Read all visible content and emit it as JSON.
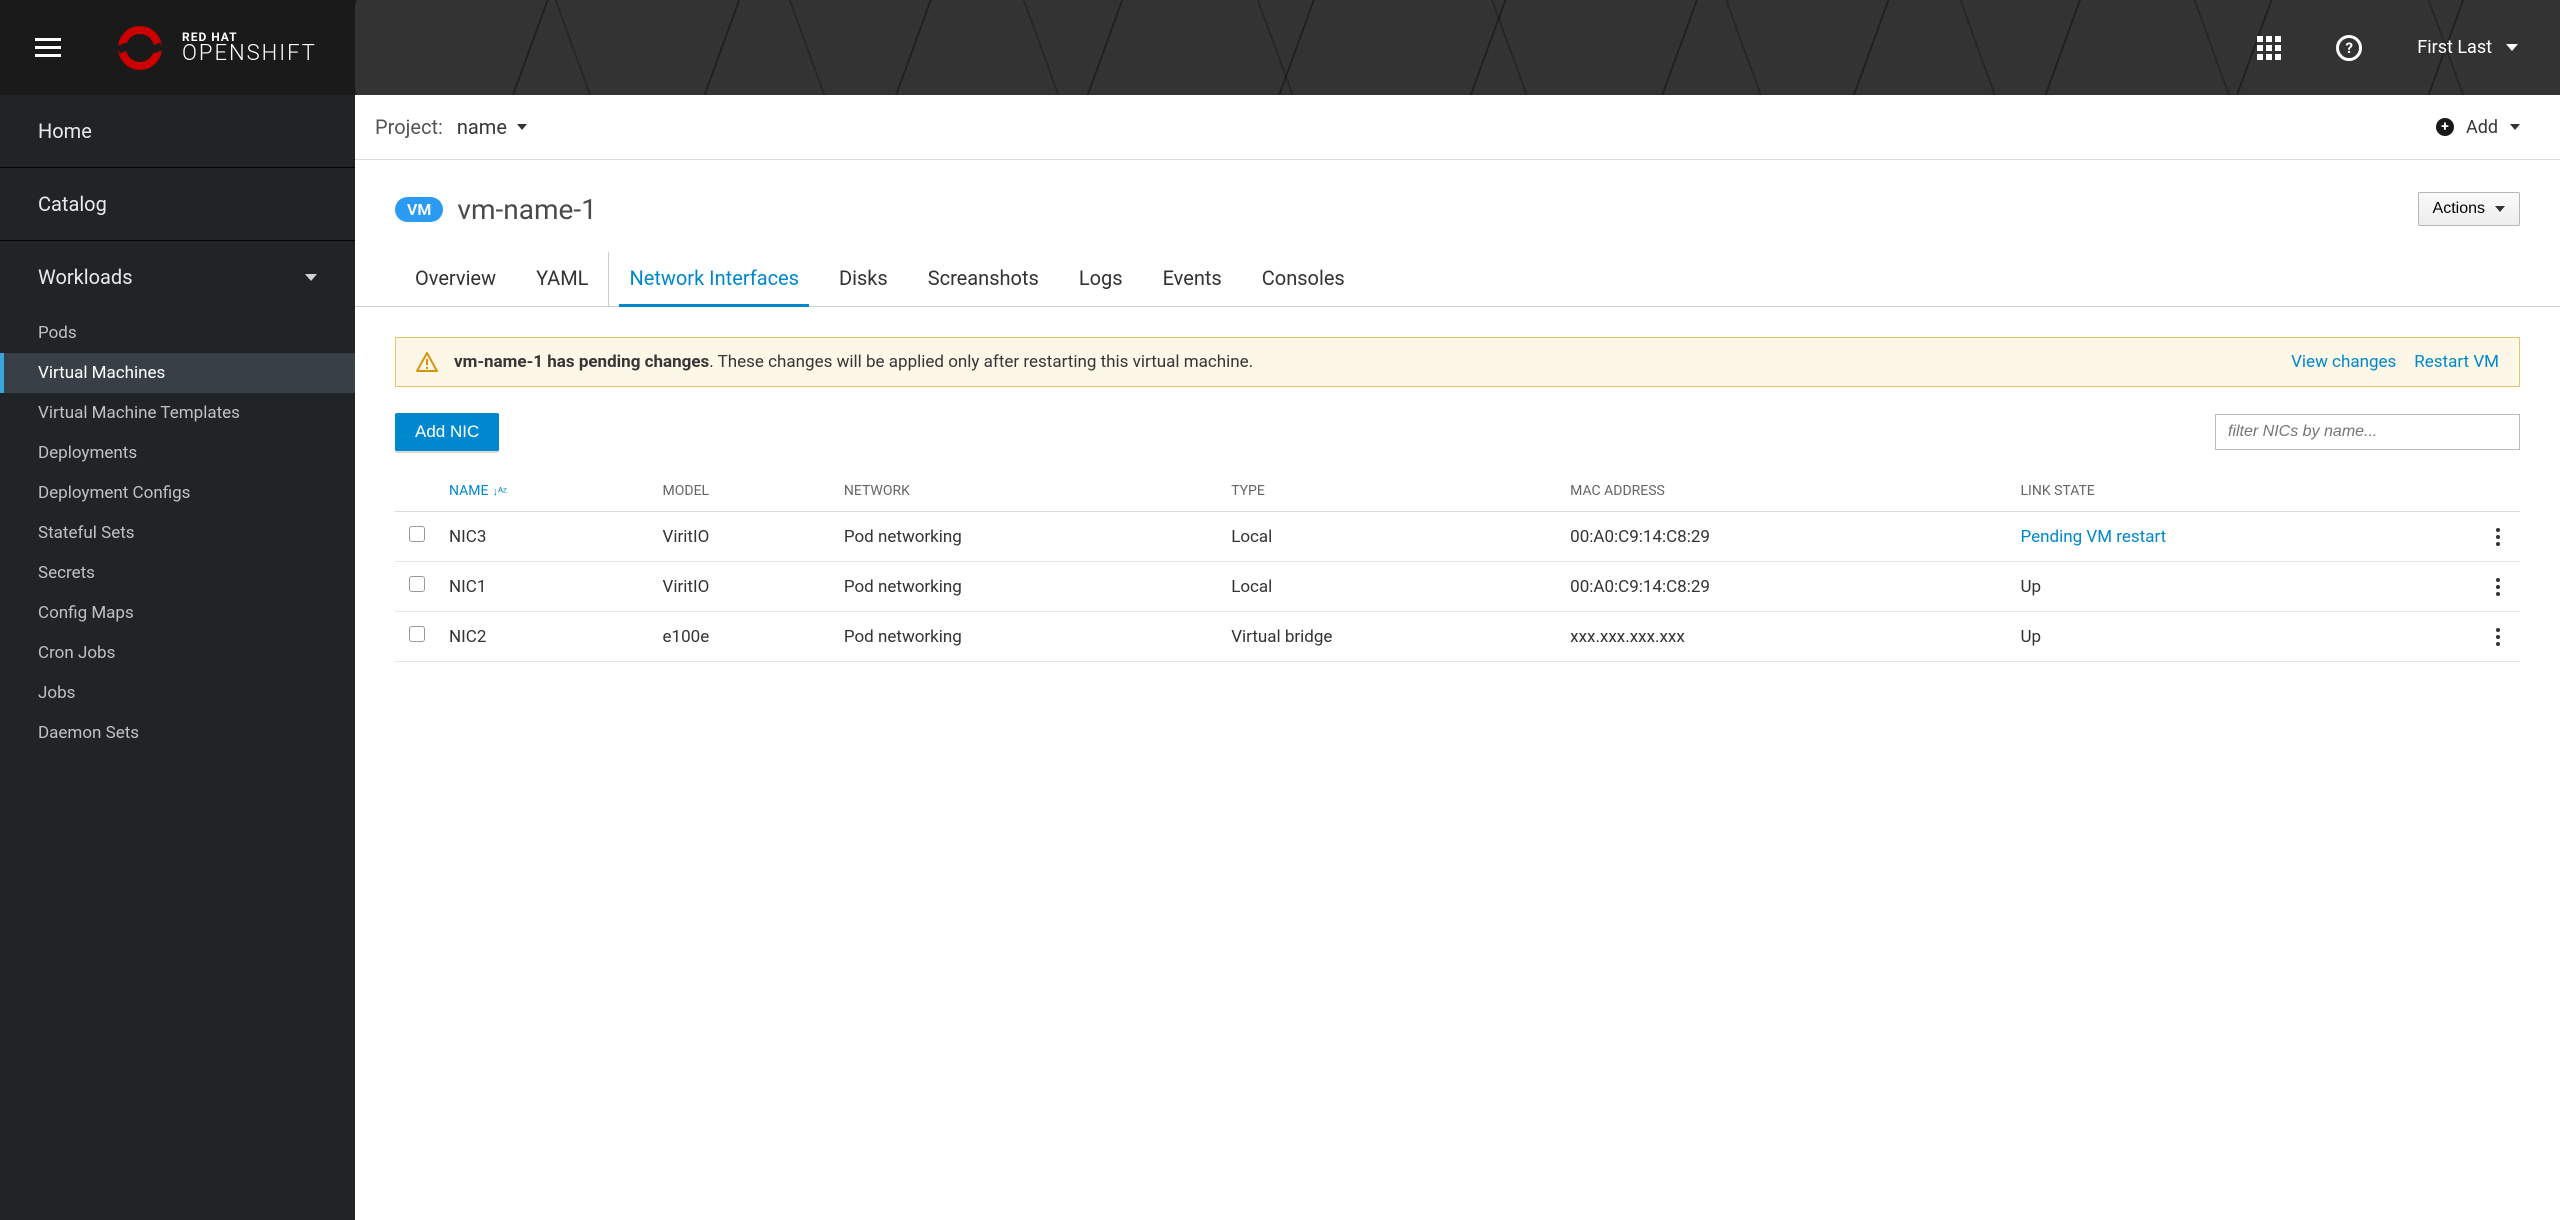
{
  "brand": {
    "line1": "RED HAT",
    "line2": "OPENSHIFT"
  },
  "topbar": {
    "user_name": "First Last"
  },
  "sidebar": {
    "home": "Home",
    "catalog": "Catalog",
    "workloads_label": "Workloads",
    "items": [
      {
        "label": "Pods"
      },
      {
        "label": "Virtual Machines"
      },
      {
        "label": "Virtual Machine Templates"
      },
      {
        "label": "Deployments"
      },
      {
        "label": "Deployment Configs"
      },
      {
        "label": "Stateful Sets"
      },
      {
        "label": "Secrets"
      },
      {
        "label": "Config Maps"
      },
      {
        "label": "Cron Jobs"
      },
      {
        "label": "Jobs"
      },
      {
        "label": "Daemon Sets"
      }
    ]
  },
  "project_bar": {
    "label": "Project:",
    "value": "name",
    "add_label": "Add"
  },
  "page": {
    "badge": "VM",
    "title": "vm-name-1",
    "actions_label": "Actions"
  },
  "tabs": [
    "Overview",
    "YAML",
    "Network Interfaces",
    "Disks",
    "Screanshots",
    "Logs",
    "Events",
    "Consoles"
  ],
  "alert": {
    "bold": "vm-name-1 has pending changes",
    "rest": ". These changes will be applied only after restarting this virtual machine.",
    "view_changes": "View changes",
    "restart": "Restart VM"
  },
  "toolbar": {
    "add_nic": "Add NIC",
    "filter_placeholder": "filter NICs by name..."
  },
  "table": {
    "headers": {
      "name": "NAME",
      "model": "MODEL",
      "network": "NETWORK",
      "type": "TYPE",
      "mac": "MAC ADDRESS",
      "link": "LINK STATE"
    },
    "rows": [
      {
        "name": "NIC3",
        "model": "ViritIO",
        "network": "Pod networking",
        "type": "Local",
        "mac": "00:A0:C9:14:C8:29",
        "link": "Pending VM restart",
        "link_pending": true
      },
      {
        "name": "NIC1",
        "model": "ViritIO",
        "network": "Pod networking",
        "type": "Local",
        "mac": "00:A0:C9:14:C8:29",
        "link": "Up",
        "link_pending": false
      },
      {
        "name": "NIC2",
        "model": "e100e",
        "network": "Pod networking",
        "type": "Virtual bridge",
        "mac": "xxx.xxx.xxx.xxx",
        "link": "Up",
        "link_pending": false
      }
    ]
  }
}
